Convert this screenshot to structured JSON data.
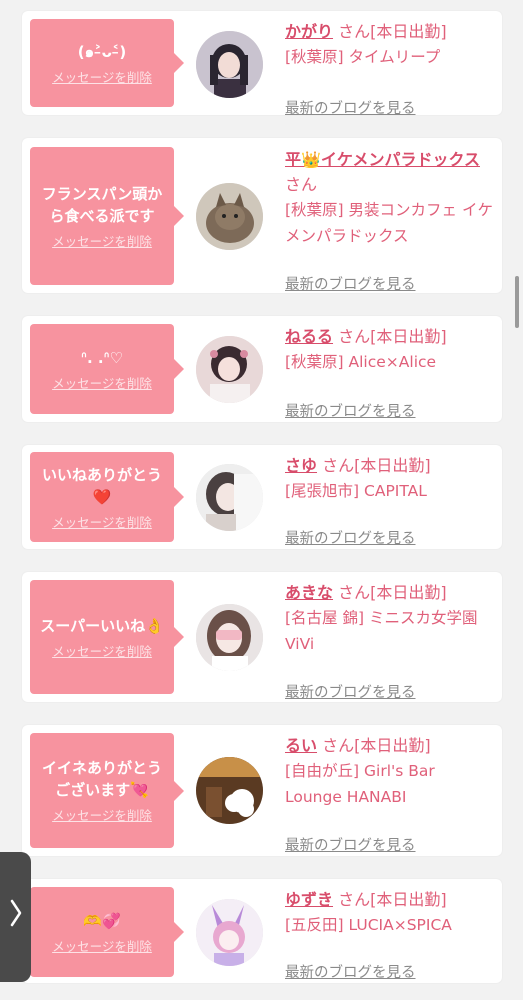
{
  "delete_label": "メッセージを削除",
  "blog_label": "最新のブログを見る",
  "san": "さん",
  "colors": {
    "bubble": "#f7939f",
    "accent": "#e0607a",
    "handle": "#4a4a4a"
  },
  "side_handle_icon": "chevron-right-icon",
  "cards": [
    {
      "message": "(๑˃̵ᴗ˂̵)",
      "name": "かがり",
      "status": "[本日出勤]",
      "shop": "[秋葉原] タイムリープ"
    },
    {
      "message": "フランスパン頭から食べる派です",
      "name": "平👑イケメンパラドックス",
      "status": "",
      "shop": "[秋葉原] 男装コンカフェ イケメンパラドックス"
    },
    {
      "message": "ᐢ.   .ᐢ♡",
      "name": "ねるる",
      "status": "[本日出勤]",
      "shop": "[秋葉原] Alice×Alice"
    },
    {
      "message": "いいねありがとう❤️",
      "name": "さゆ",
      "status": "[本日出勤]",
      "shop": "[尾張旭市] CAPITAL"
    },
    {
      "message": "スーパーいいね👌",
      "name": "あきな",
      "status": "[本日出勤]",
      "shop": "[名古屋 錦] ミニスカ女学園ViVi"
    },
    {
      "message": "イイネありがとうございます💘",
      "name": "るい",
      "status": "[本日出勤]",
      "shop": "[自由が丘] Girl's Bar Lounge HANABI"
    },
    {
      "message": "🫶💞",
      "name": "ゆずき",
      "status": "[本日出勤]",
      "shop": "[五反田] LUCIA×SPICA"
    }
  ]
}
